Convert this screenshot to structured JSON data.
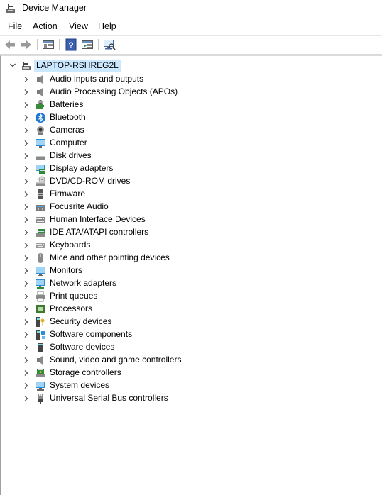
{
  "window": {
    "title": "Device Manager",
    "icon": "device-manager-icon"
  },
  "menu": [
    {
      "label": "File"
    },
    {
      "label": "Action"
    },
    {
      "label": "View"
    },
    {
      "label": "Help"
    }
  ],
  "toolbar": [
    {
      "icon": "back-arrow-icon"
    },
    {
      "icon": "forward-arrow-icon"
    },
    {
      "icon": "properties-icon"
    },
    {
      "icon": "help-icon"
    },
    {
      "icon": "show-hide-console-tree-icon"
    },
    {
      "icon": "scan-for-hardware-changes-icon"
    }
  ],
  "tree": {
    "root": {
      "label": "LAPTOP-RSHREG2L",
      "icon": "computer-icon",
      "expanded": true
    },
    "categories": [
      {
        "label": "Audio inputs and outputs",
        "icon": "speaker-icon"
      },
      {
        "label": "Audio Processing Objects (APOs)",
        "icon": "speaker-icon"
      },
      {
        "label": "Batteries",
        "icon": "battery-icon"
      },
      {
        "label": "Bluetooth",
        "icon": "bluetooth-icon"
      },
      {
        "label": "Cameras",
        "icon": "camera-icon"
      },
      {
        "label": "Computer",
        "icon": "monitor-icon"
      },
      {
        "label": "Disk drives",
        "icon": "disk-drive-icon"
      },
      {
        "label": "Display adapters",
        "icon": "display-adapter-icon"
      },
      {
        "label": "DVD/CD-ROM drives",
        "icon": "dvd-drive-icon"
      },
      {
        "label": "Firmware",
        "icon": "firmware-icon"
      },
      {
        "label": "Focusrite Audio",
        "icon": "audio-device-icon"
      },
      {
        "label": "Human Interface Devices",
        "icon": "hid-icon"
      },
      {
        "label": "IDE ATA/ATAPI controllers",
        "icon": "ide-controller-icon"
      },
      {
        "label": "Keyboards",
        "icon": "keyboard-icon"
      },
      {
        "label": "Mice and other pointing devices",
        "icon": "mouse-icon"
      },
      {
        "label": "Monitors",
        "icon": "monitor-icon"
      },
      {
        "label": "Network adapters",
        "icon": "network-adapter-icon"
      },
      {
        "label": "Print queues",
        "icon": "printer-icon"
      },
      {
        "label": "Processors",
        "icon": "processor-icon"
      },
      {
        "label": "Security devices",
        "icon": "security-device-icon"
      },
      {
        "label": "Software components",
        "icon": "software-component-icon"
      },
      {
        "label": "Software devices",
        "icon": "software-device-icon"
      },
      {
        "label": "Sound, video and game controllers",
        "icon": "speaker-icon"
      },
      {
        "label": "Storage controllers",
        "icon": "storage-controller-icon"
      },
      {
        "label": "System devices",
        "icon": "system-device-icon"
      },
      {
        "label": "Universal Serial Bus controllers",
        "icon": "usb-icon"
      }
    ]
  },
  "colors": {
    "selection": "#cce8ff",
    "accent": "#1e90ff"
  }
}
